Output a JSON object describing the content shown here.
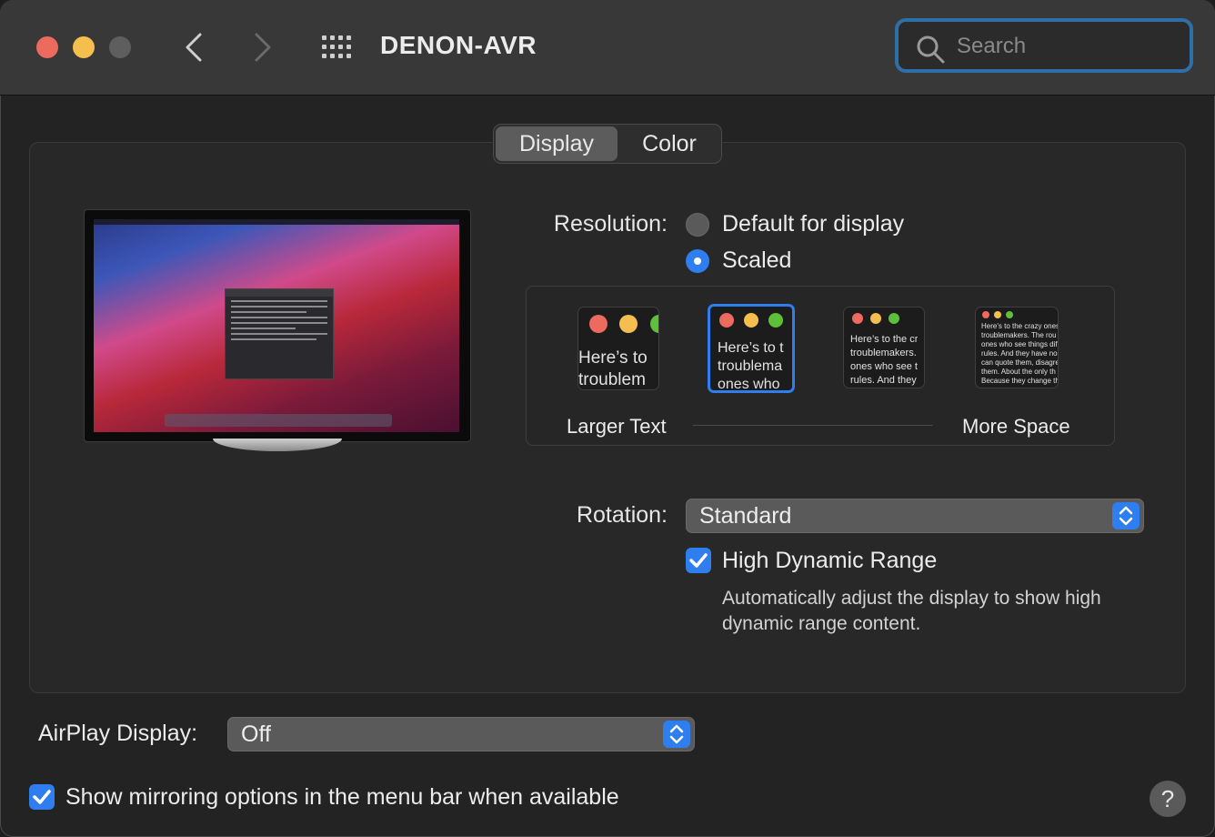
{
  "window": {
    "title": "DENON-AVR"
  },
  "search": {
    "placeholder": "Search"
  },
  "tabs": [
    {
      "label": "Display"
    },
    {
      "label": "Color"
    }
  ],
  "resolution": {
    "label": "Resolution:",
    "options": [
      {
        "label": "Default for display",
        "selected": false
      },
      {
        "label": "Scaled",
        "selected": true
      }
    ],
    "scale_left_label": "Larger Text",
    "scale_right_label": "More Space",
    "scale_selected_index": 1,
    "thumbnail_sample_lines": [
      [
        "Here’s to",
        "troublem"
      ],
      [
        "Here’s to t",
        "troublema",
        "ones who"
      ],
      [
        "Here’s to the cr",
        "troublemakers.",
        "ones who see t",
        "rules. And they"
      ],
      [
        "Here's to the crazy ones",
        "troublemakers. The rou",
        "ones who see things dif",
        "rules. And they have no",
        "can quote them, disagre",
        "them. About the only th",
        "Because they change th"
      ]
    ]
  },
  "rotation": {
    "label": "Rotation:",
    "value": "Standard"
  },
  "hdr": {
    "label": "High Dynamic Range",
    "checked": true,
    "description_line1": "Automatically adjust the display to show high",
    "description_line2": "dynamic range content."
  },
  "airplay": {
    "label": "AirPlay Display:",
    "value": "Off"
  },
  "mirroring": {
    "label": "Show mirroring options in the menu bar when available",
    "checked": true
  },
  "help": {
    "label": "?"
  },
  "colors": {
    "accent": "#2f7ef0",
    "close": "#ed6a5e",
    "minimize": "#f5bf4f",
    "zoom_disabled": "#5e5e5e",
    "green": "#5ec03a"
  }
}
